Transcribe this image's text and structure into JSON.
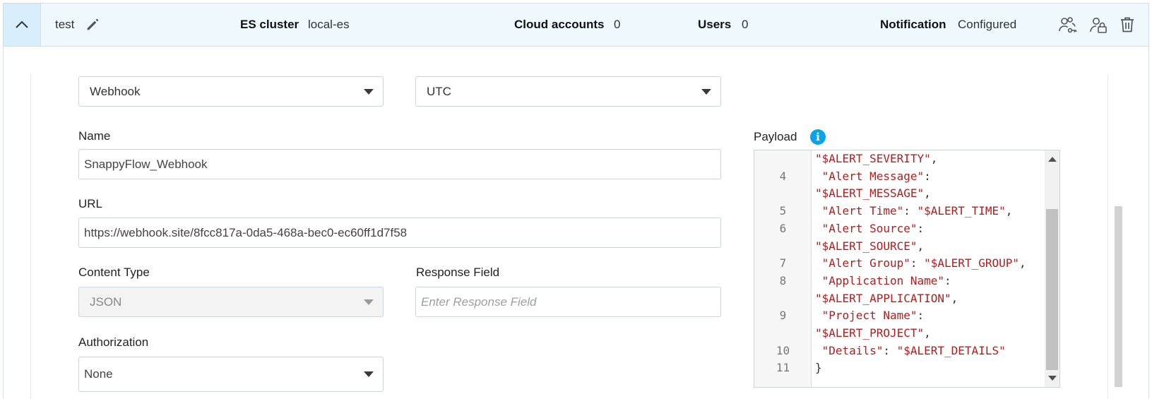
{
  "header": {
    "name": "test",
    "es_cluster_label": "ES cluster",
    "es_cluster_value": "local-es",
    "cloud_accounts_label": "Cloud accounts",
    "cloud_accounts_value": "0",
    "users_label": "Users",
    "users_value": "0",
    "notification_label": "Notification",
    "notification_value": "Configured",
    "icons": [
      "chevron-up-icon",
      "edit-pencil-icon",
      "users-key-icon",
      "user-lock-icon",
      "trash-icon"
    ]
  },
  "form": {
    "type_select": "Webhook",
    "timezone_select": "UTC",
    "name_label": "Name",
    "name_value": "SnappyFlow_Webhook",
    "url_label": "URL",
    "url_value": "https://webhook.site/8fcc817a-0da5-468a-bec0-ec60ff1d7f58",
    "content_type_label": "Content Type",
    "content_type_value": "JSON",
    "response_field_label": "Response Field",
    "response_field_placeholder": "Enter Response Field",
    "authorization_label": "Authorization",
    "authorization_value": "None",
    "payload_label": "Payload"
  },
  "payload_lines": [
    {
      "num": "",
      "segments": [
        {
          "t": "\"$ALERT_SEVERITY\"",
          "c": "str"
        },
        {
          "t": ",",
          "c": "punc"
        }
      ]
    },
    {
      "num": "4",
      "segments": [
        {
          "t": " \"Alert Message\"",
          "c": "str"
        },
        {
          "t": ":",
          "c": "punc"
        }
      ]
    },
    {
      "num": "",
      "segments": [
        {
          "t": "\"$ALERT_MESSAGE\"",
          "c": "str"
        },
        {
          "t": ",",
          "c": "punc"
        }
      ]
    },
    {
      "num": "5",
      "segments": [
        {
          "t": " \"Alert Time\"",
          "c": "str"
        },
        {
          "t": ": ",
          "c": "punc"
        },
        {
          "t": "\"$ALERT_TIME\"",
          "c": "str"
        },
        {
          "t": ",",
          "c": "punc"
        }
      ]
    },
    {
      "num": "6",
      "segments": [
        {
          "t": " \"Alert Source\"",
          "c": "str"
        },
        {
          "t": ":",
          "c": "punc"
        }
      ]
    },
    {
      "num": "",
      "segments": [
        {
          "t": "\"$ALERT_SOURCE\"",
          "c": "str"
        },
        {
          "t": ",",
          "c": "punc"
        }
      ]
    },
    {
      "num": "7",
      "segments": [
        {
          "t": " \"Alert Group\"",
          "c": "str"
        },
        {
          "t": ": ",
          "c": "punc"
        },
        {
          "t": "\"$ALERT_GROUP\"",
          "c": "str"
        },
        {
          "t": ",",
          "c": "punc"
        }
      ]
    },
    {
      "num": "8",
      "segments": [
        {
          "t": " \"Application Name\"",
          "c": "str"
        },
        {
          "t": ":",
          "c": "punc"
        }
      ]
    },
    {
      "num": "",
      "segments": [
        {
          "t": "\"$ALERT_APPLICATION\"",
          "c": "str"
        },
        {
          "t": ",",
          "c": "punc"
        }
      ]
    },
    {
      "num": "9",
      "segments": [
        {
          "t": " \"Project Name\"",
          "c": "str"
        },
        {
          "t": ":",
          "c": "punc"
        }
      ]
    },
    {
      "num": "",
      "segments": [
        {
          "t": "\"$ALERT_PROJECT\"",
          "c": "str"
        },
        {
          "t": ",",
          "c": "punc"
        }
      ]
    },
    {
      "num": "10",
      "segments": [
        {
          "t": " \"Details\"",
          "c": "str"
        },
        {
          "t": ": ",
          "c": "punc"
        },
        {
          "t": "\"$ALERT_DETAILS\"",
          "c": "str"
        }
      ]
    },
    {
      "num": "11",
      "segments": [
        {
          "t": "}",
          "c": "punc"
        }
      ]
    }
  ],
  "colors": {
    "header_bg": "#f0f9fe",
    "collapse_bg": "#d9eefc",
    "info_accent": "#0aa3e8",
    "code_string": "#b21e1e"
  }
}
